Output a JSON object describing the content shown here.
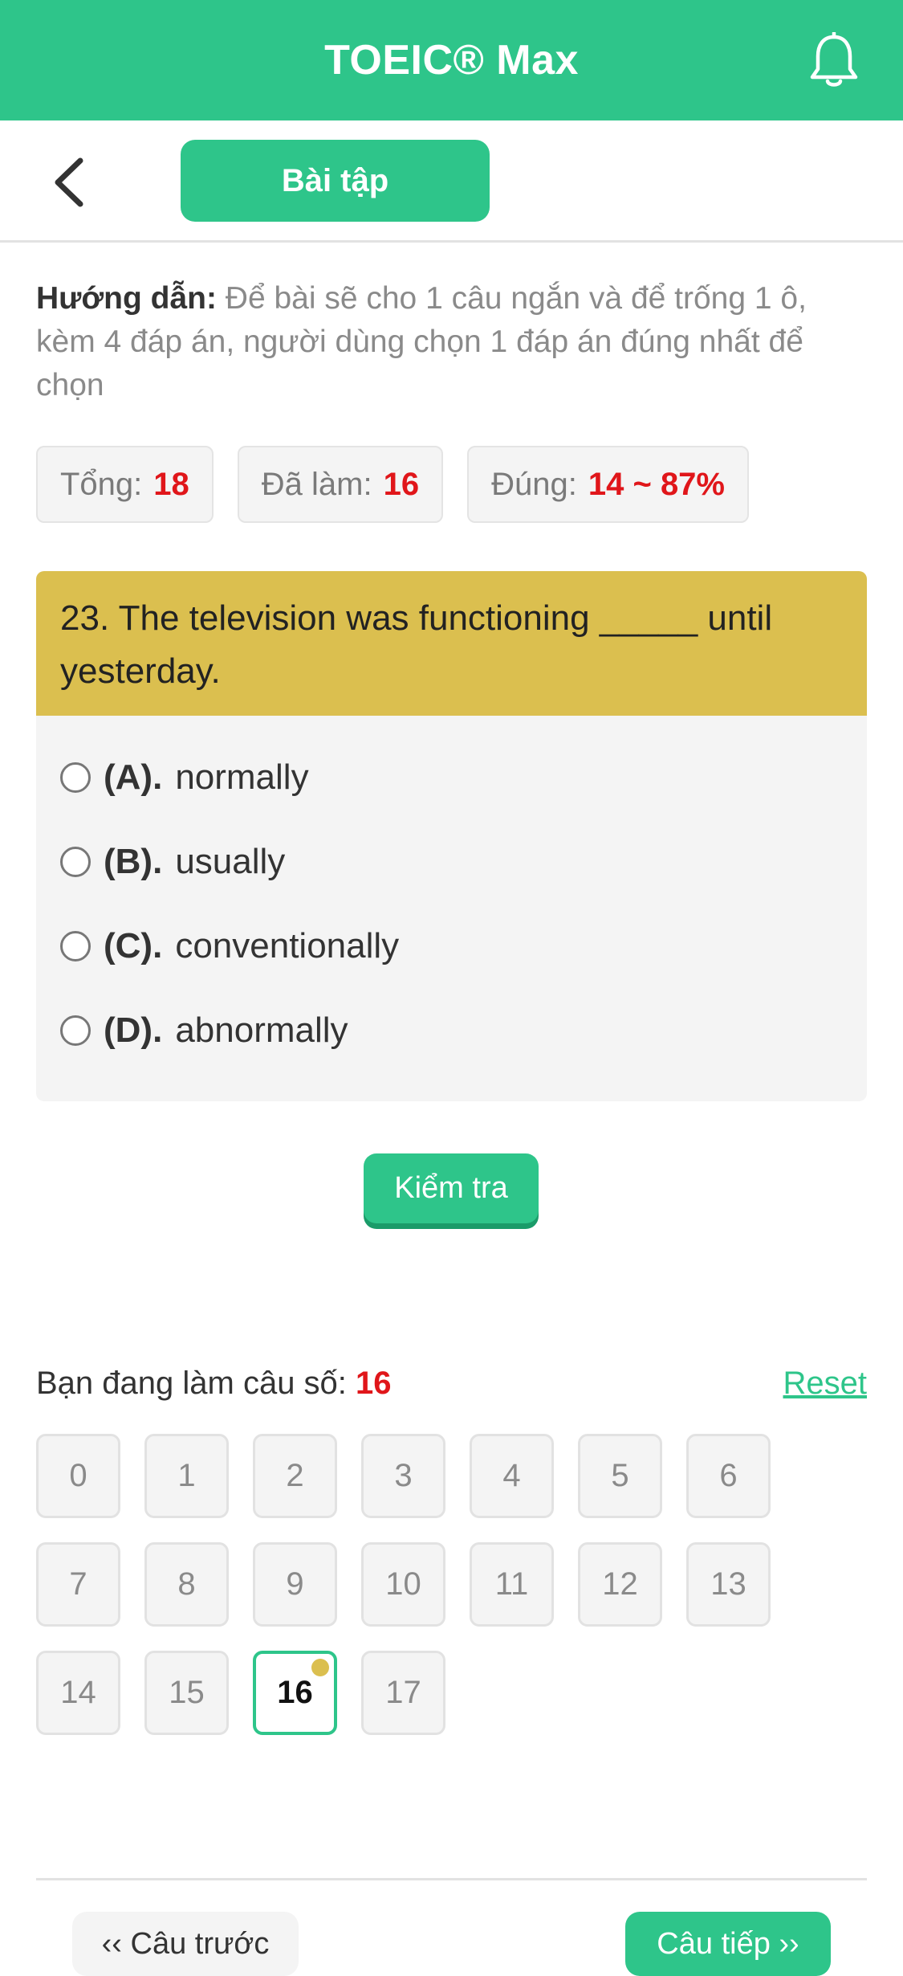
{
  "app": {
    "title": "TOEIC® Max",
    "bell_icon": "bell-icon",
    "brand_color": "#2ec58a"
  },
  "nav": {
    "back_icon": "chevron-left-icon",
    "tab_label": "Bài tập"
  },
  "instruction": {
    "label": "Hướng dẫn:",
    "text": " Để bài sẽ cho 1 câu ngắn và để trống 1 ô, kèm 4 đáp án, người dùng chọn 1 đáp án đúng nhất để chọn"
  },
  "stats": {
    "total_label": "Tổng:",
    "total": "18",
    "done_label": "Đã làm:",
    "done": "16",
    "correct_label": "Đúng:",
    "correct": "14 ~ 87%"
  },
  "question": {
    "text": "23. The television was functioning _____ until yesterday.",
    "options": [
      {
        "letter": "(A).",
        "text": "normally"
      },
      {
        "letter": "(B).",
        "text": "usually"
      },
      {
        "letter": "(C).",
        "text": "conventionally"
      },
      {
        "letter": "(D).",
        "text": "abnormally"
      }
    ]
  },
  "check_button": "Kiểm tra",
  "progress": {
    "label": "Bạn đang làm câu số: ",
    "current": "16",
    "reset": "Reset",
    "numbers": [
      "0",
      "1",
      "2",
      "3",
      "4",
      "5",
      "6",
      "7",
      "8",
      "9",
      "10",
      "11",
      "12",
      "13",
      "14",
      "15",
      "16",
      "17"
    ],
    "active_index": 16
  },
  "footer": {
    "prev": "‹‹ Câu trước",
    "next": "Câu tiếp ››"
  }
}
